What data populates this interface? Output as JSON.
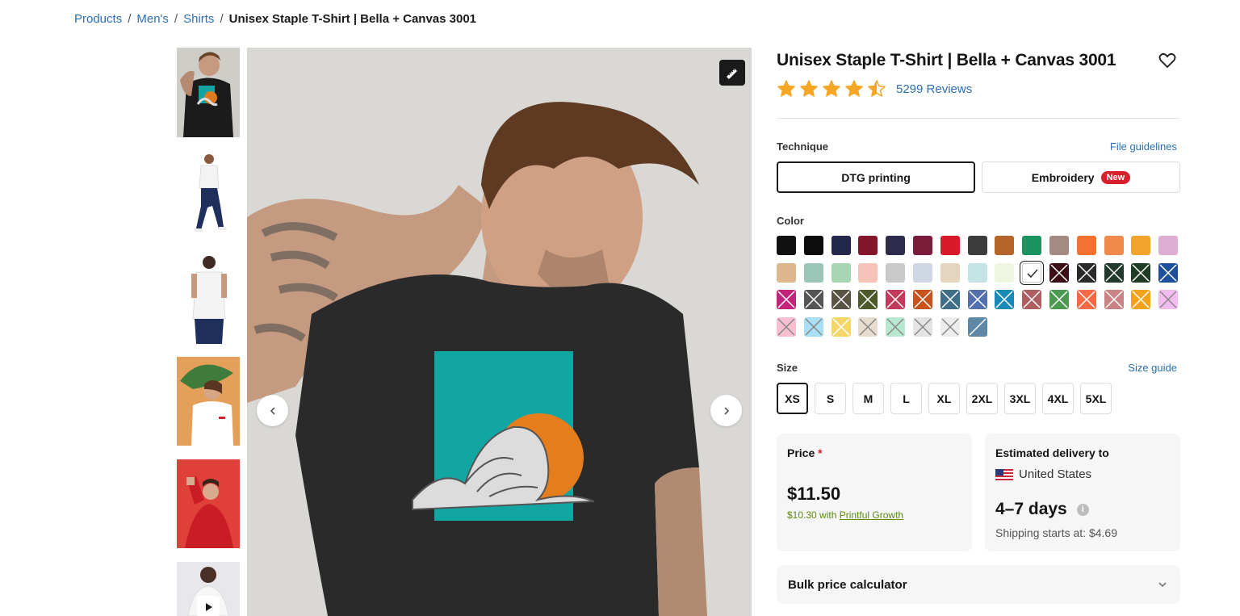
{
  "breadcrumb": {
    "items": [
      "Products",
      "Men's",
      "Shirts"
    ],
    "separator": "/",
    "current": "Unisex Staple T-Shirt | Bella + Canvas 3001"
  },
  "gallery": {
    "thumbnails": [
      {
        "name": "thumb-black-tee-model",
        "kind": "photo"
      },
      {
        "name": "thumb-white-tee-walking",
        "kind": "photo"
      },
      {
        "name": "thumb-white-tee-back",
        "kind": "photo"
      },
      {
        "name": "thumb-white-tee-leaf",
        "kind": "photo"
      },
      {
        "name": "thumb-red-tee",
        "kind": "photo"
      },
      {
        "name": "thumb-video",
        "kind": "video"
      }
    ],
    "active_index": 0,
    "icons": {
      "measure": "ruler-icon",
      "prev": "chevron-left-icon",
      "next": "chevron-right-icon",
      "play": "play-icon"
    }
  },
  "product": {
    "title": "Unisex Staple T-Shirt | Bella + Canvas 3001",
    "rating": 4.5,
    "reviews": "5299 Reviews",
    "favorite_icon": "heart-icon",
    "star_color": "#f5a623"
  },
  "technique": {
    "label": "Technique",
    "link": "File guidelines",
    "options": [
      "DTG printing",
      "Embroidery"
    ],
    "selected": "DTG printing",
    "badge": "New"
  },
  "color": {
    "label": "Color",
    "swatches": [
      {
        "hex": "#111111",
        "available": true
      },
      {
        "hex": "#0c0c0c",
        "available": true
      },
      {
        "hex": "#23284a",
        "available": true
      },
      {
        "hex": "#84162b",
        "available": true
      },
      {
        "hex": "#2d2b4c",
        "available": true
      },
      {
        "hex": "#7a1c3a",
        "available": true
      },
      {
        "hex": "#d91a2a",
        "available": true
      },
      {
        "hex": "#3b3b3b",
        "available": true
      },
      {
        "hex": "#b5652a",
        "available": true
      },
      {
        "hex": "#1c9460",
        "available": true
      },
      {
        "hex": "#a48a80",
        "available": true
      },
      {
        "hex": "#f27330",
        "available": true
      },
      {
        "hex": "#ef8a4a",
        "available": true
      },
      {
        "hex": "#f0a42b",
        "available": true
      },
      {
        "hex": "#dcaed3",
        "available": true
      },
      {
        "hex": "#ddb88e",
        "available": true
      },
      {
        "hex": "#9cc6b8",
        "available": true
      },
      {
        "hex": "#a8d6b4",
        "available": true
      },
      {
        "hex": "#f5c3b8",
        "available": true
      },
      {
        "hex": "#c9c9c9",
        "available": true
      },
      {
        "hex": "#cfd7e4",
        "available": true
      },
      {
        "hex": "#e6d5be",
        "available": true
      },
      {
        "hex": "#c4e3e5",
        "available": true
      },
      {
        "hex": "#eef6e2",
        "available": true
      },
      {
        "hex": "#ffffff",
        "available": true,
        "selected": true
      },
      {
        "hex": "#3a0e15",
        "available": false
      },
      {
        "hex": "#2a2a2a",
        "available": false
      },
      {
        "hex": "#223a2c",
        "available": false
      },
      {
        "hex": "#1f3d25",
        "available": false
      },
      {
        "hex": "#1e4f9a",
        "available": false
      },
      {
        "hex": "#c3237a",
        "available": false
      },
      {
        "hex": "#555555",
        "available": false
      },
      {
        "hex": "#5b5344",
        "available": false
      },
      {
        "hex": "#4f5a2c",
        "available": false
      },
      {
        "hex": "#c23a5c",
        "available": false
      },
      {
        "hex": "#c8531d",
        "available": false
      },
      {
        "hex": "#3f6e88",
        "available": false
      },
      {
        "hex": "#5570b0",
        "available": false
      },
      {
        "hex": "#1a8ab8",
        "available": false
      },
      {
        "hex": "#b05f60",
        "available": false
      },
      {
        "hex": "#4c9a52",
        "available": false
      },
      {
        "hex": "#f46a44",
        "available": false
      },
      {
        "hex": "#c98384",
        "available": false
      },
      {
        "hex": "#f3a21b",
        "available": false
      },
      {
        "hex": "#f3bcef",
        "available": false
      },
      {
        "hex": "#f7bfcf",
        "available": false
      },
      {
        "hex": "#a9dff2",
        "available": false
      },
      {
        "hex": "#f5d66a",
        "available": false
      },
      {
        "hex": "#e7dccd",
        "available": false
      },
      {
        "hex": "#b8e8cf",
        "available": false
      },
      {
        "hex": "#e4e4e2",
        "available": false
      },
      {
        "hex": "#ededed",
        "available": false
      },
      {
        "hex": "#5f88a6",
        "available": false,
        "style": "slash"
      }
    ]
  },
  "size": {
    "label": "Size",
    "link": "Size guide",
    "options": [
      "XS",
      "S",
      "M",
      "L",
      "XL",
      "2XL",
      "3XL",
      "4XL",
      "5XL"
    ],
    "selected": "XS"
  },
  "price": {
    "label": "Price",
    "required_mark": "*",
    "value": "$11.50",
    "growth_prefix": "$10.30 with",
    "growth_link": "Printful Growth"
  },
  "delivery": {
    "label": "Estimated delivery to",
    "country": "United States",
    "days": "4–7 days",
    "info_icon": "info-icon",
    "shipping": "Shipping starts at: $4.69"
  },
  "bulk": {
    "label": "Bulk price calculator",
    "icon": "chevron-down-icon"
  },
  "colors": {
    "link": "#2c6fb3",
    "accent_red": "#d8202c",
    "growth_green": "#5a8a0e"
  }
}
